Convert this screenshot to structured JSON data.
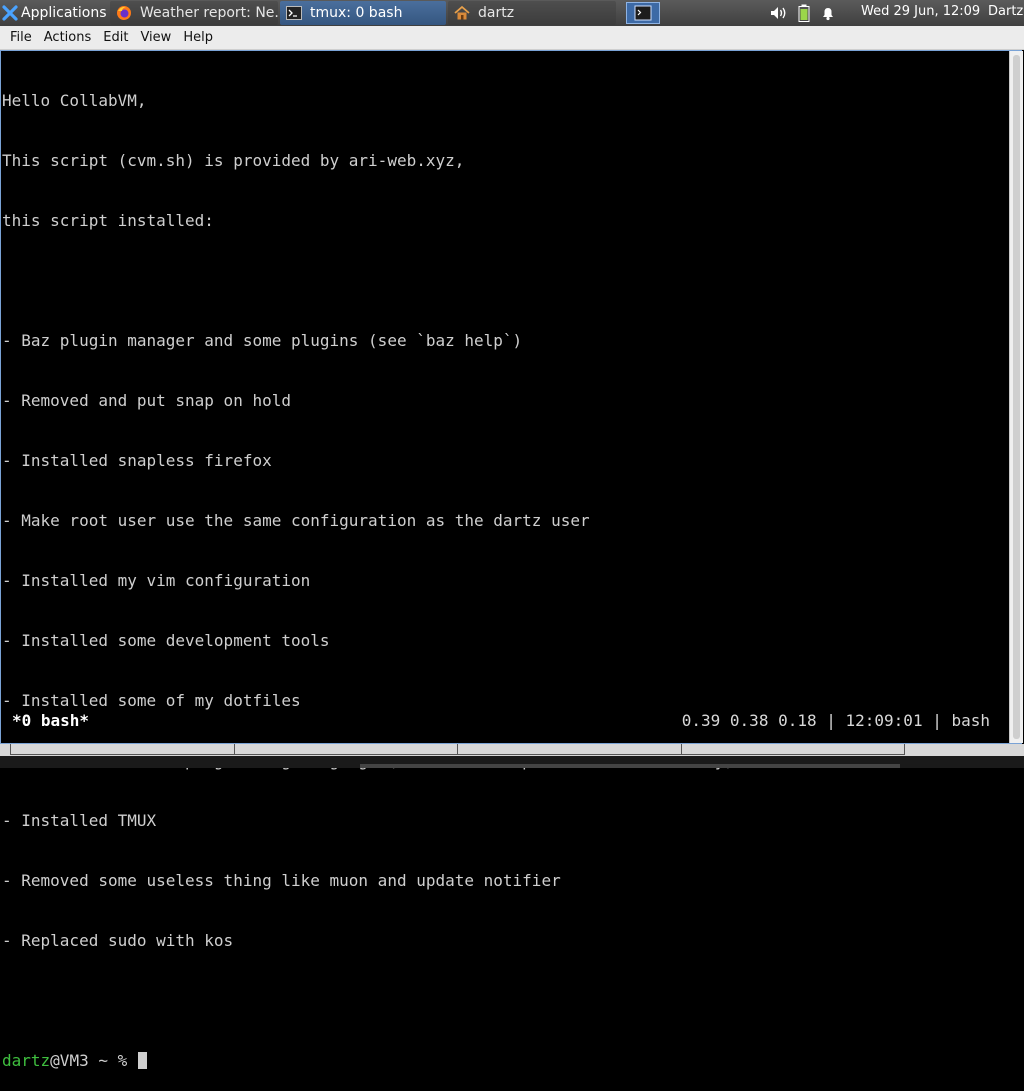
{
  "panel": {
    "applications_label": "Applications",
    "applications_sep": "☰",
    "tasks": [
      {
        "label": "Weather report: Ne...",
        "icon": "firefox-icon"
      },
      {
        "label": "tmux: 0 bash",
        "icon": "terminal-icon"
      },
      {
        "label": "dartz",
        "icon": "home-folder-icon"
      }
    ],
    "clock": "Wed 29 Jun, 12:09",
    "user": "Dartz"
  },
  "menubar": {
    "items": [
      "File",
      "Actions",
      "Edit",
      "View",
      "Help"
    ]
  },
  "terminal": {
    "lines": [
      "Hello CollabVM,",
      "This script (cvm.sh) is provided by ari-web.xyz,",
      "this script installed:",
      "",
      "- Baz plugin manager and some plugins (see `baz help`)",
      "- Removed and put snap on hold",
      "- Installed snapless firefox",
      "- Make root user use the same configuration as the dartz user",
      "- Installed my vim configuration",
      "- Installed some development tools",
      "- Installed some of my dotfiles",
      "- Installed the fa programming language (see `fac -help` and ~/fa directory)",
      "- Installed TMUX",
      "- Removed some useless thing like muon and update notifier",
      "- Replaced sudo with kos",
      ""
    ],
    "prompt_user": "dartz",
    "prompt_rest": "@VM3 ~ % "
  },
  "tmux": {
    "left": "*0 bash*",
    "right": "0.39 0.38 0.18 | 12:09:01 | bash"
  },
  "colors": {
    "prompt_green": "#3fbf3f",
    "active_task": "#355680"
  }
}
